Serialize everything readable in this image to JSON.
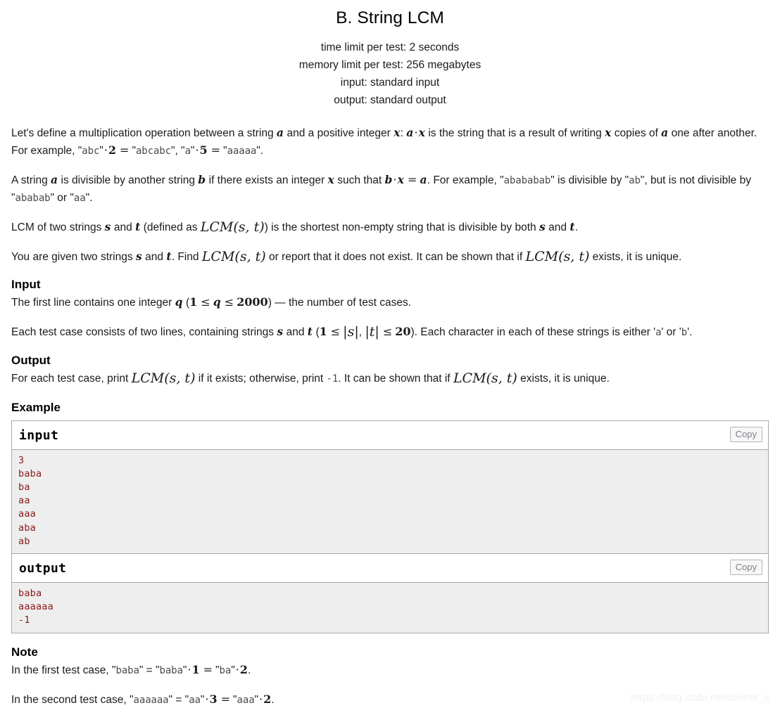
{
  "header": {
    "title": "B. String LCM",
    "time_limit": "time limit per test: 2 seconds",
    "memory_limit": "memory limit per test: 256 megabytes",
    "input_spec": "input: standard input",
    "output_spec": "output: standard output"
  },
  "legend": {
    "p1_a": "Let's define a multiplication operation between a string ",
    "p1_var_a1": "a",
    "p1_b": " and a positive integer ",
    "p1_var_x1": "x",
    "p1_c": ": ",
    "p1_var_a2": "a",
    "p1_dot1": "·",
    "p1_var_x2": "x",
    "p1_d": " is the string that is a result of writing ",
    "p1_var_x3": "x",
    "p1_e": " copies of ",
    "p1_var_a3": "a",
    "p1_f": " one after another. For example, ",
    "p1_q1": "\"",
    "p1_tt_abc": "abc",
    "p1_q2": "\"",
    "p1_dot2": "·",
    "p1_num2": "2",
    "p1_eq1": "=",
    "p1_q3": "\"",
    "p1_tt_abcabc": "abcabc",
    "p1_q4": "\", \"",
    "p1_tt_a": "a",
    "p1_q5": "\"",
    "p1_dot3": "·",
    "p1_num5": "5",
    "p1_eq2": "=",
    "p1_q6": "\"",
    "p1_tt_aaaaa": "aaaaa",
    "p1_q7": "\".",
    "p2_a": "A string ",
    "p2_var_a": "a",
    "p2_b": " is divisible by another string ",
    "p2_var_b": "b",
    "p2_c": " if there exists an integer ",
    "p2_var_x": "x",
    "p2_d": " such that ",
    "p2_var_b2": "b",
    "p2_dot": "·",
    "p2_var_x2": "x",
    "p2_eq": "=",
    "p2_var_a2": "a",
    "p2_e": ". For example, \"",
    "p2_tt_abababab": "abababab",
    "p2_f": "\" is divisible by \"",
    "p2_tt_ab": "ab",
    "p2_g": "\", but is not divisible by \"",
    "p2_tt_ababab": "ababab",
    "p2_h": "\" or \"",
    "p2_tt_aa": "aa",
    "p2_i": "\".",
    "p3_a": "LCM of two strings ",
    "p3_var_s": "s",
    "p3_b": " and ",
    "p3_var_t": "t",
    "p3_c": " (defined as ",
    "p3_lcm": "LCM(s, t)",
    "p3_d": ") is the shortest non-empty string that is divisible by both ",
    "p3_var_s2": "s",
    "p3_e": " and ",
    "p3_var_t2": "t",
    "p3_f": ".",
    "p4_a": "You are given two strings ",
    "p4_var_s": "s",
    "p4_b": " and ",
    "p4_var_t": "t",
    "p4_c": ". Find ",
    "p4_lcm1": "LCM(s, t)",
    "p4_d": " or report that it does not exist. It can be shown that if ",
    "p4_lcm2": "LCM(s, t)",
    "p4_e": " exists, it is unique."
  },
  "input_section": {
    "heading": "Input",
    "p1_a": "The first line contains one integer ",
    "p1_var_q": "q",
    "p1_b": " (",
    "p1_num1": "1",
    "p1_le1": "≤",
    "p1_var_q2": "q",
    "p1_le2": "≤",
    "p1_num2000": "2000",
    "p1_c": ") — the number of test cases.",
    "p2_a": "Each test case consists of two lines, containing strings ",
    "p2_var_s": "s",
    "p2_b": " and ",
    "p2_var_t": "t",
    "p2_c": " (",
    "p2_num1": "1",
    "p2_le1": "≤",
    "p2_abs_s": "|s|",
    "p2_comma": ", ",
    "p2_abs_t": "|t|",
    "p2_le2": "≤",
    "p2_num20": "20",
    "p2_d": "). Each character in each of these strings is either '",
    "p2_tt_a": "a",
    "p2_e": "' or '",
    "p2_tt_b": "b",
    "p2_f": "'."
  },
  "output_section": {
    "heading": "Output",
    "p1_a": "For each test case, print ",
    "p1_lcm1": "LCM(s, t)",
    "p1_b": " if it exists; otherwise, print ",
    "p1_tt_minus1": "-1",
    "p1_c": ". It can be shown that if ",
    "p1_lcm2": "LCM(s, t)",
    "p1_d": " exists, it is unique."
  },
  "example_section": {
    "heading": "Example",
    "input_label": "input",
    "output_label": "output",
    "copy_label": "Copy",
    "input_text": "3\nbaba\nba\naa\naaa\naba\nab",
    "output_text": "baba\naaaaaa\n-1"
  },
  "note_section": {
    "heading": "Note",
    "p1_a": "In the first test case, \"",
    "p1_tt_baba1": "baba",
    "p1_b": "\" = \"",
    "p1_tt_baba2": "baba",
    "p1_c": "\"",
    "p1_dot1": "·",
    "p1_num1": "1",
    "p1_eq": "=",
    "p1_d": "\"",
    "p1_tt_ba": "ba",
    "p1_e": "\"",
    "p1_dot2": "·",
    "p1_num2": "2",
    "p1_f": ".",
    "p2_a": "In the second test case, \"",
    "p2_tt_a6": "aaaaaa",
    "p2_b": "\" = \"",
    "p2_tt_aa": "aa",
    "p2_c": "\"",
    "p2_dot1": "·",
    "p2_num3": "3",
    "p2_eq": "=",
    "p2_d": "\"",
    "p2_tt_aaa": "aaa",
    "p2_e": "\"",
    "p2_dot2": "·",
    "p2_num2": "2",
    "p2_f": "."
  },
  "watermark": {
    "text": "https://blog.csdn.net/diviner_s"
  },
  "colors": {
    "sample_text": "#8b1a1a",
    "sample_bg": "#eeeeee",
    "border": "#a9a9a9",
    "body_text": "#1b1b1b",
    "mono_text": "#4a4a4a",
    "watermark": "#f0f0f0"
  }
}
